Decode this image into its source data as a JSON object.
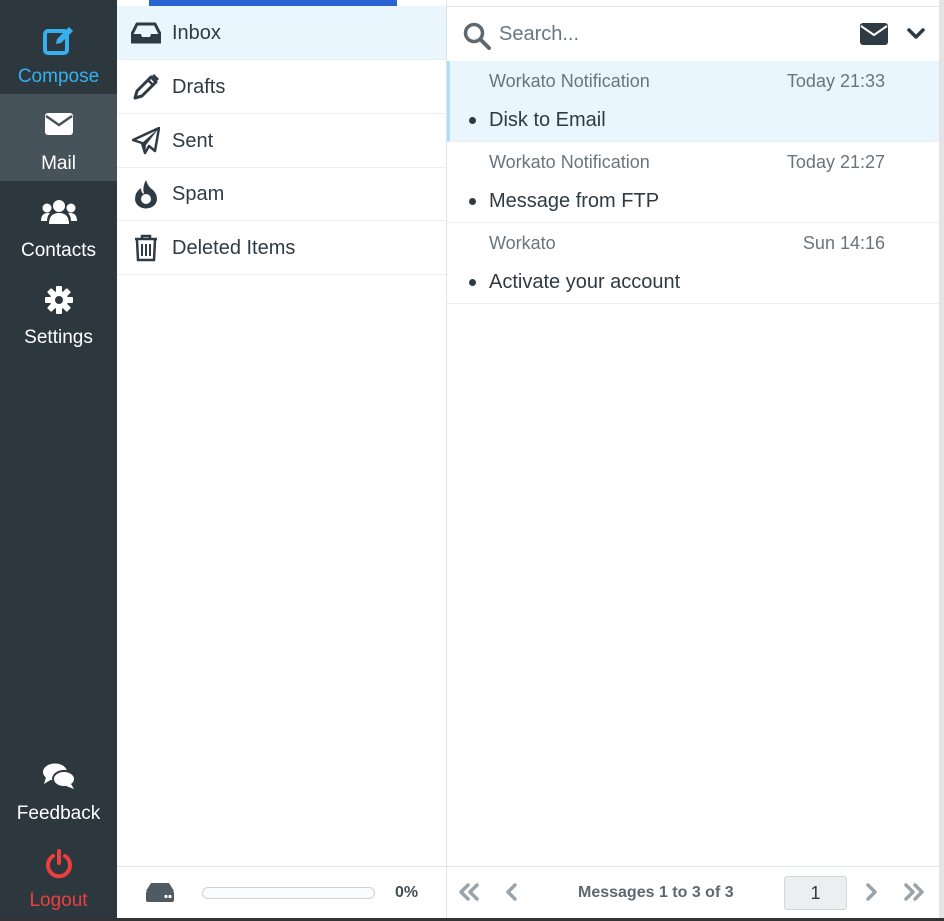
{
  "nav": {
    "compose": "Compose",
    "mail": "Mail",
    "contacts": "Contacts",
    "settings": "Settings",
    "feedback": "Feedback",
    "logout": "Logout"
  },
  "folders": {
    "items": [
      {
        "label": "Inbox",
        "icon": "inbox-icon"
      },
      {
        "label": "Drafts",
        "icon": "pencil-icon"
      },
      {
        "label": "Sent",
        "icon": "paper-plane-icon"
      },
      {
        "label": "Spam",
        "icon": "fire-icon"
      },
      {
        "label": "Deleted Items",
        "icon": "trash-icon"
      }
    ],
    "quota": {
      "percent_text": "0%",
      "fraction": 0
    }
  },
  "search": {
    "placeholder": "Search..."
  },
  "messages": [
    {
      "from": "Workato Notification",
      "date": "Today 21:33",
      "subject": "Disk to Email"
    },
    {
      "from": "Workato Notification",
      "date": "Today 21:27",
      "subject": "Message from FTP"
    },
    {
      "from": "Workato",
      "date": "Sun 14:16",
      "subject": "Activate your account"
    }
  ],
  "pager": {
    "text": "Messages 1 to 3 of 3",
    "page": "1"
  },
  "colors": {
    "sidebar": "#2d373e",
    "sidebar_active": "#46535b",
    "accent": "#37b1ee",
    "logout": "#ec4040",
    "selected_row": "#e9f6fd",
    "top_bar": "#2a64d3"
  }
}
